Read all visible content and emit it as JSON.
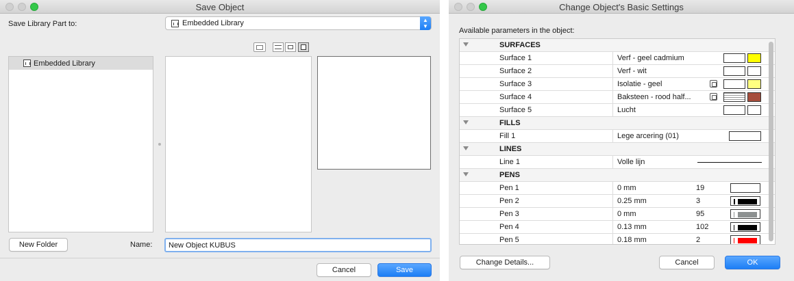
{
  "save_dialog": {
    "title": "Save Object",
    "save_to_label": "Save Library Part to:",
    "library_select_value": "Embedded Library",
    "tree_item": "Embedded Library",
    "new_folder_button": "New Folder",
    "name_label": "Name:",
    "name_value": "New Object KUBUS",
    "cancel_button": "Cancel",
    "save_button": "Save"
  },
  "settings_dialog": {
    "title": "Change Object's Basic Settings",
    "params_label": "Available parameters in the object:",
    "groups": {
      "surfaces": "SURFACES",
      "fills": "FILLS",
      "lines": "LINES",
      "pens": "PENS"
    },
    "surfaces": [
      {
        "name": "Surface 1",
        "value": "Verf - geel cadmium",
        "color": "#ffff00"
      },
      {
        "name": "Surface 2",
        "value": "Verf - wit",
        "color": "#ffffff"
      },
      {
        "name": "Surface 3",
        "value": "Isolatie - geel",
        "color": "#ffff80"
      },
      {
        "name": "Surface 4",
        "value": "Baksteen - rood half...",
        "color": "#a64d3c"
      },
      {
        "name": "Surface 5",
        "value": "Lucht",
        "color": "#ffffff"
      }
    ],
    "fills": [
      {
        "name": "Fill 1",
        "value": "Lege arcering (01)"
      }
    ],
    "lines": [
      {
        "name": "Line 1",
        "value": "Volle lijn"
      }
    ],
    "pens": [
      {
        "name": "Pen 1",
        "value": "0 mm",
        "number": "19",
        "color": "#ffffff"
      },
      {
        "name": "Pen 2",
        "value": "0.25 mm",
        "number": "3",
        "color": "#000000"
      },
      {
        "name": "Pen 3",
        "value": "0 mm",
        "number": "95",
        "color": "#8c9090"
      },
      {
        "name": "Pen 4",
        "value": "0.13 mm",
        "number": "102",
        "color": "#000000"
      },
      {
        "name": "Pen 5",
        "value": "0.18 mm",
        "number": "2",
        "color": "#ff0000"
      }
    ],
    "change_details_button": "Change Details...",
    "cancel_button": "Cancel",
    "ok_button": "OK"
  }
}
